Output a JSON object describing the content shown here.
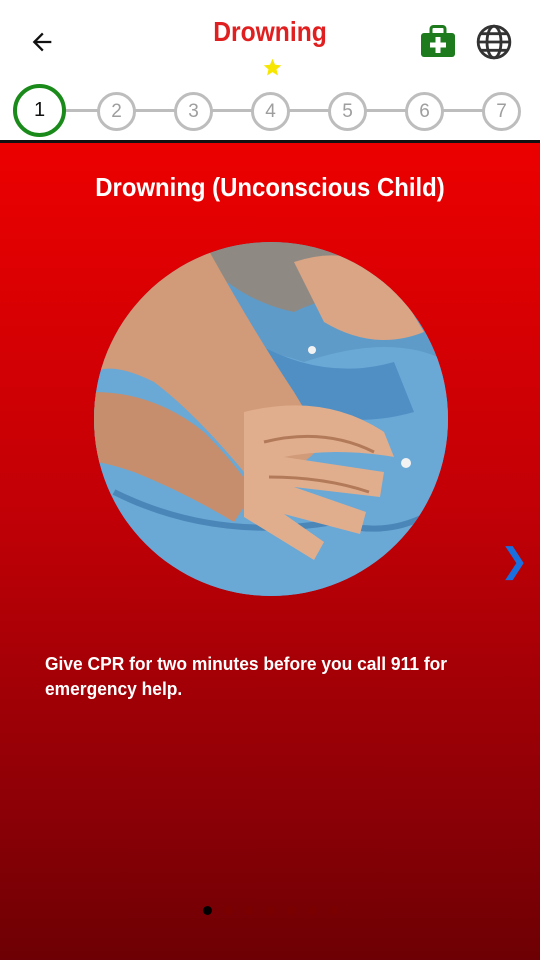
{
  "header": {
    "title": "Drowning"
  },
  "icons": {
    "back": "arrow-left-icon",
    "favorite": "star-icon",
    "first_aid": "first-aid-kit-icon",
    "language": "globe-icon",
    "next": "chevron-right-icon"
  },
  "stepper": {
    "steps": [
      "1",
      "2",
      "3",
      "4",
      "5",
      "6",
      "7"
    ],
    "active": 1
  },
  "content": {
    "heading": "Drowning (Unconscious Child)",
    "instruction": "Give CPR for two minutes before you call 911 for emergency help.",
    "image_alt": "Hands performing chest compressions on a person in a blue denim shirt"
  },
  "pager": {
    "total": 7,
    "current": 1
  },
  "colors": {
    "title": "#e02020",
    "accent_green": "#1a8a1a",
    "next_arrow": "#1a6fe0",
    "content_top": "#ec0000",
    "content_bottom": "#6d0004"
  }
}
